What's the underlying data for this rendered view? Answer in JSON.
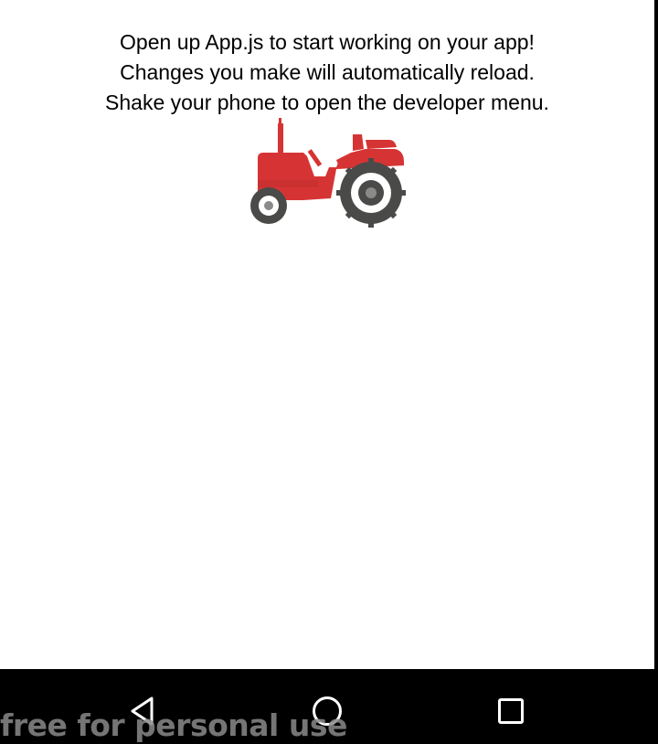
{
  "message": {
    "line1": "Open up App.js to start working on your app!",
    "line2": "Changes you make will automatically reload.",
    "line3": "Shake your phone to open the developer menu."
  },
  "image": {
    "icon": "tractor-icon",
    "colors": {
      "body": "#d63434",
      "wheel": "#4a4a48",
      "hub": "#ffffff",
      "hub_center": "#8a8a8a"
    }
  },
  "nav_bar": {
    "back_icon": "back-triangle-icon",
    "home_icon": "home-circle-icon",
    "recents_icon": "recents-square-icon",
    "background": "#000000",
    "icon_color": "#ffffff"
  },
  "watermark": {
    "text": "free for personal use"
  }
}
